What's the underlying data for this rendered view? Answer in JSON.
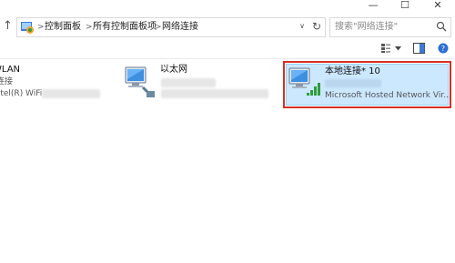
{
  "window": {
    "minimize_glyph": "—",
    "maximize_glyph": "☐",
    "close_glyph": "✕"
  },
  "address_bar": {
    "crumbs": [
      "控制面板",
      "所有控制面板项",
      "网络连接"
    ],
    "separator": ">",
    "dropdown_glyph": "∨",
    "refresh_glyph": "↻",
    "up_glyph": "↑"
  },
  "search": {
    "placeholder": "搜索\"网络连接\""
  },
  "connections": [
    {
      "name": "WLAN",
      "status": "未连接",
      "adapter": "Intel(R) WiFi"
    },
    {
      "name": "以太网"
    },
    {
      "name": "本地连接* 10",
      "adapter": "Microsoft Hosted Network Vir..."
    }
  ],
  "colors": {
    "highlight_border": "#d93025",
    "selection_fill": "#cce8ff",
    "signal_green": "#2e9d3a"
  }
}
